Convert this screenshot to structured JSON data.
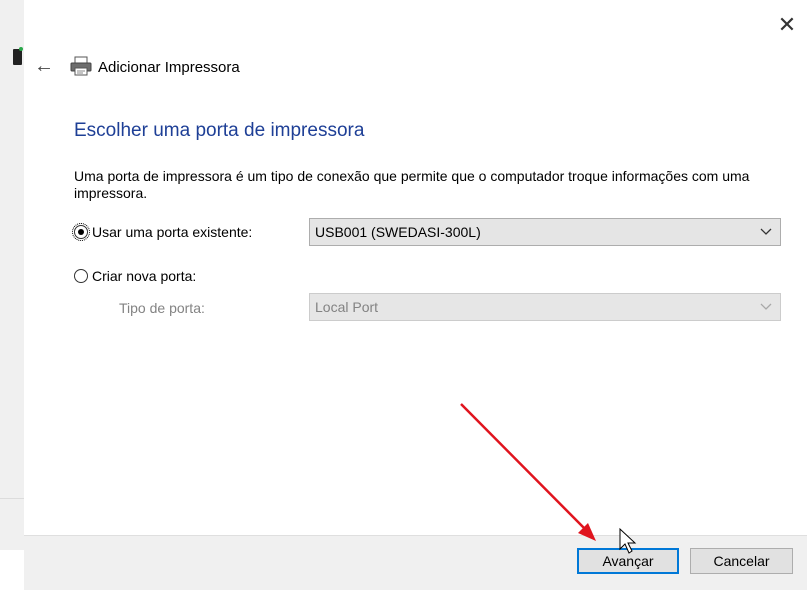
{
  "window": {
    "title": "Adicionar Impressora",
    "close_symbol": "✕",
    "back_symbol": "←"
  },
  "page": {
    "heading": "Escolher uma porta de impressora",
    "description": "Uma porta de impressora é um tipo de conexão que permite que o computador troque informações com uma impressora."
  },
  "options": {
    "existing_port": {
      "label": "Usar uma porta existente:",
      "selected": true,
      "value": "USB001 (SWEDASI-300L)"
    },
    "new_port": {
      "label": "Criar nova porta:",
      "selected": false,
      "type_label": "Tipo de porta:",
      "type_value": "Local Port",
      "disabled": true
    }
  },
  "footer": {
    "next_label": "Avançar",
    "cancel_label": "Cancelar"
  },
  "colors": {
    "heading": "#1e3f96",
    "primary_border": "#0078d7",
    "annotation_arrow": "#e0141e"
  },
  "icons": [
    "printer-icon",
    "back-arrow-icon",
    "close-icon",
    "chevron-down-icon",
    "mouse-cursor-icon",
    "red-arrow-annotation"
  ]
}
